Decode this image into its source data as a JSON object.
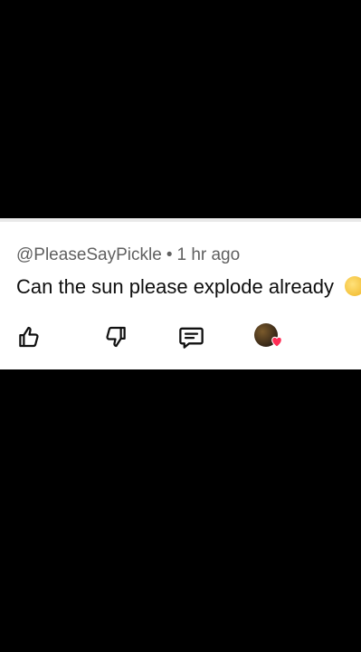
{
  "comment": {
    "author": "@PleaseSayPickle",
    "separator": "•",
    "time": "1 hr ago",
    "text": "Can the sun please explode already"
  },
  "icons": {
    "like": "thumbs-up-icon",
    "dislike": "thumbs-down-icon",
    "reply": "reply-comment-icon",
    "creator_heart": "creator-heart-icon"
  },
  "colors": {
    "background": "#000000",
    "card": "#ffffff",
    "meta_text": "#606060",
    "comment_text": "#0f0f0f",
    "heart": "#ff2d55"
  }
}
